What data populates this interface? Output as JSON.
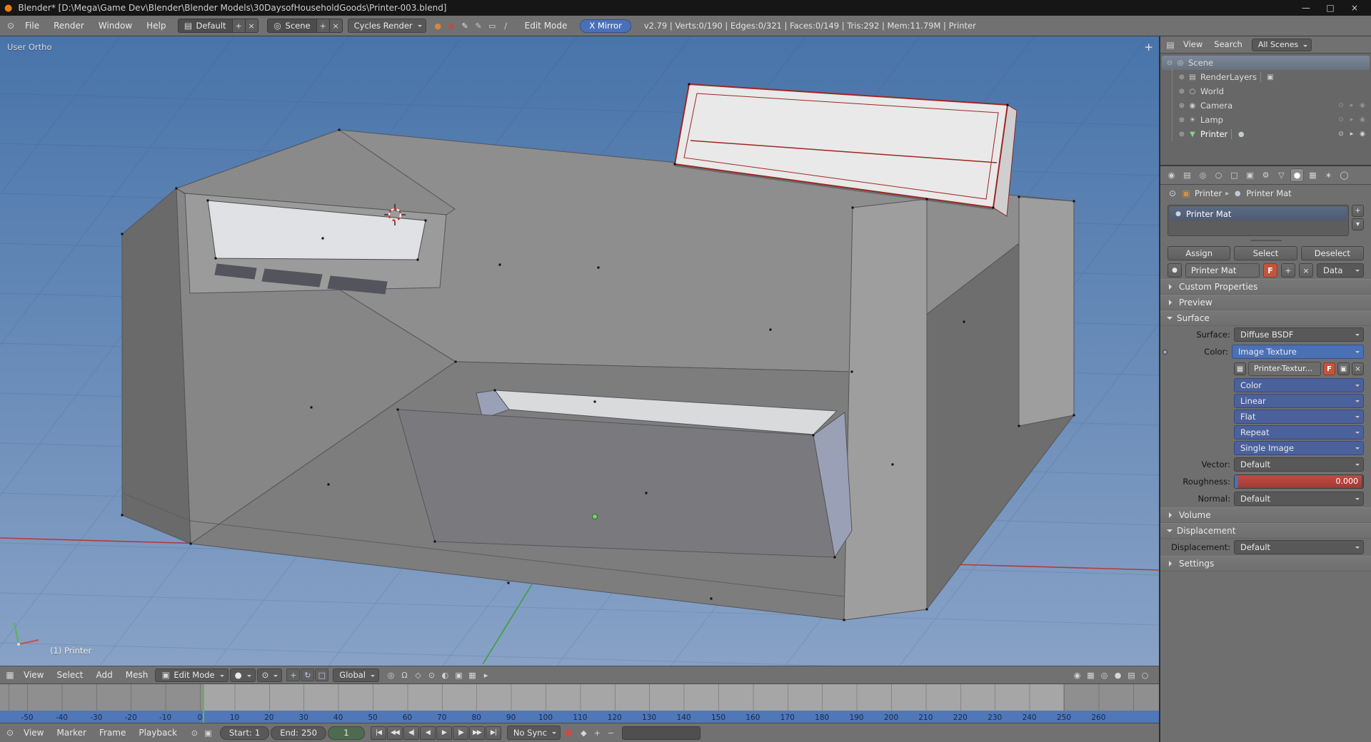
{
  "colors": {
    "accent": "#4a71b8",
    "header": "#717171",
    "panel": "#6f6f6f",
    "widget": "#585858",
    "widget_blue": "#4a619c",
    "widget_blue_bright": "#4a70b5",
    "slider_red": "#b03f3c",
    "strip_blue": "#5077b8",
    "playhead_green": "#62b54f",
    "blender_orange": "#e87d0d",
    "f_button": "#c3553e",
    "vp_top": "#4874aa",
    "vp_bottom": "#88a2c6"
  },
  "titlebar": {
    "logo_glyph": "●",
    "title": "Blender* [D:\\Mega\\Game Dev\\Blender\\Blender Models\\30DaysofHouseholdGoods\\Printer-003.blend]",
    "minimize": "—",
    "maximize": "□",
    "close": "×"
  },
  "menubar": {
    "editor_glyph": "⊙",
    "menus": {
      "file": "File",
      "render": "Render",
      "window": "Window",
      "help": "Help"
    },
    "layout": {
      "icon_glyph": "▤",
      "value": "Default",
      "add": "+",
      "remove": "×"
    },
    "scene": {
      "icon_glyph": "◎",
      "value": "Scene",
      "add": "+",
      "remove": "×"
    },
    "engine": "Cycles Render",
    "icon_cluster": [
      {
        "name": "matcap-sphere-icon",
        "glyph": "●",
        "color": "#d8863b"
      },
      {
        "name": "texture-sphere-icon",
        "glyph": "◉",
        "color": "#c04a42"
      },
      {
        "name": "grease-pencil-icon",
        "glyph": "✎",
        "color": "#e2e2e2"
      },
      {
        "name": "annotate-pen-icon",
        "glyph": "✎",
        "color": "#c8c8c8"
      },
      {
        "name": "ruler-icon",
        "glyph": "▭",
        "color": "#d5d5d5"
      },
      {
        "name": "line-tool-icon",
        "glyph": "∕",
        "color": "#d5d5d5"
      }
    ],
    "mode_label": "Edit Mode",
    "xmirror_label": "X Mirror",
    "stats": "v2.79 | Verts:0/190 | Edges:0/321 | Faces:0/149 | Tris:292 | Mem:11.79M | Printer"
  },
  "viewport": {
    "view_label": "User Ortho",
    "object_label": "(1) Printer",
    "add_panel_glyph": "+"
  },
  "outliner": {
    "editor_glyph": "▤",
    "menus": {
      "view": "View",
      "search": "Search"
    },
    "scenes_filter": "All Scenes",
    "items": [
      {
        "label": "Scene",
        "disclosure": "⊖",
        "icon_glyph": "◎"
      },
      {
        "label": "RenderLayers",
        "disclosure": "⊕",
        "icon_glyph": "▤",
        "trail_icon": "▣"
      },
      {
        "label": "World",
        "disclosure": "⊕",
        "icon_glyph": "○"
      },
      {
        "label": "Camera",
        "disclosure": "⊕",
        "icon_glyph": "◉"
      },
      {
        "label": "Lamp",
        "disclosure": "⊕",
        "icon_glyph": "☀"
      },
      {
        "label": "Printer",
        "disclosure": "⊕",
        "icon_glyph": "▼",
        "trail_icon": "●"
      }
    ],
    "restrict_icons": [
      "⊙",
      "▸",
      "◉"
    ]
  },
  "properties": {
    "tabs": [
      {
        "name": "tab-render",
        "glyph": "◉"
      },
      {
        "name": "tab-render-layers",
        "glyph": "▤"
      },
      {
        "name": "tab-scene",
        "glyph": "◎"
      },
      {
        "name": "tab-world",
        "glyph": "○"
      },
      {
        "name": "tab-object",
        "glyph": "□"
      },
      {
        "name": "tab-constraints",
        "glyph": "▣"
      },
      {
        "name": "tab-modifiers",
        "glyph": "⚙"
      },
      {
        "name": "tab-object-data",
        "glyph": "▽"
      },
      {
        "name": "tab-material",
        "glyph": "●",
        "active": true
      },
      {
        "name": "tab-texture",
        "glyph": "▦"
      },
      {
        "name": "tab-particles",
        "glyph": "∗"
      },
      {
        "name": "tab-physics",
        "glyph": "◯"
      }
    ],
    "breadcrumb": {
      "pin_glyph": "⊙",
      "object_icon": "▣",
      "object": "Printer",
      "arrow": "▸",
      "material_icon": "●",
      "material": "Printer Mat"
    },
    "slot": {
      "item_icon": "●",
      "item": "Printer Mat",
      "add": "+",
      "menu": "▾"
    },
    "actions": {
      "assign": "Assign",
      "select": "Select",
      "deselect": "Deselect"
    },
    "datablock": {
      "browse_icon": "●",
      "name": "Printer Mat",
      "fake_user": "F",
      "add": "+",
      "unlink": "×",
      "link_mode": "Data"
    },
    "sections": {
      "custom_properties": "Custom Properties",
      "preview": "Preview",
      "surface": "Surface",
      "volume": "Volume",
      "displacement": "Displacement",
      "settings": "Settings"
    },
    "surface": {
      "surface_label": "Surface:",
      "surface_value": "Diffuse BSDF",
      "color_label": "Color:",
      "color_value": "Image Texture",
      "texture": {
        "browse_icon": "▦",
        "name": "Printer-Textur...",
        "fake_user": "F",
        "pack_icon": "▣",
        "unlink": "×"
      },
      "tex_options": [
        "Color",
        "Linear",
        "Flat",
        "Repeat",
        "Single Image"
      ],
      "vector_label": "Vector:",
      "vector_value": "Default",
      "roughness_label": "Roughness:",
      "roughness_value": "0.000",
      "normal_label": "Normal:",
      "normal_value": "Default"
    },
    "displacement": {
      "label": "Displacement:",
      "value": "Default"
    }
  },
  "viewport_header": {
    "editor_glyph": "▦",
    "menus": {
      "view": "View",
      "select": "Select",
      "add": "Add",
      "mesh": "Mesh"
    },
    "mode_icon_glyph": "▣",
    "mode": "Edit Mode",
    "shading_glyph": "●",
    "pivot_glyph": "⊙",
    "manip_icons": [
      {
        "name": "manipulator-translate-icon",
        "glyph": "+"
      },
      {
        "name": "manipulator-rotate-icon",
        "glyph": "↻"
      },
      {
        "name": "manipulator-scale-icon",
        "glyph": "□"
      }
    ],
    "orientation": "Global",
    "mid_icons": [
      {
        "name": "proportional-edit-icon",
        "glyph": "◎"
      },
      {
        "name": "snap-magnet-icon",
        "glyph": "Ω"
      },
      {
        "name": "snap-element-icon",
        "glyph": "◇"
      },
      {
        "name": "snap-target-icon",
        "glyph": "⊙"
      },
      {
        "name": "render-preview-icon",
        "glyph": "◐"
      },
      {
        "name": "occlude-geometry-icon",
        "glyph": "▣"
      },
      {
        "name": "normals-display-icon",
        "glyph": "▦"
      },
      {
        "name": "header-expand-icon",
        "glyph": "▸"
      }
    ],
    "right_icons": [
      {
        "name": "opengl-render-icon",
        "glyph": "◉"
      },
      {
        "name": "opengl-anim-icon",
        "glyph": "▦"
      },
      {
        "name": "viewport-shading-extra-icon",
        "glyph": "◎"
      },
      {
        "name": "matcap-icon",
        "glyph": "●"
      },
      {
        "name": "grid-toggle-icon",
        "glyph": "▤"
      },
      {
        "name": "camera-lock-icon",
        "glyph": "○"
      }
    ]
  },
  "timeline": {
    "editor_glyph": "⊙",
    "menus": {
      "view": "View",
      "marker": "Marker",
      "frame": "Frame",
      "playback": "Playback"
    },
    "pre_icons": [
      {
        "name": "use-preview-range-icon",
        "glyph": "⊙"
      },
      {
        "name": "lock-time-icon",
        "glyph": "▣"
      }
    ],
    "start_label": "Start:",
    "start_value": "1",
    "end_label": "End:",
    "end_value": "250",
    "current_frame": "1",
    "playback_buttons": [
      "|◀",
      "◀◀",
      "◀|",
      "◀",
      "▶",
      "|▶",
      "▶▶",
      "▶|"
    ],
    "sync": "No Sync",
    "record_glyph": "●",
    "keying_icons": [
      {
        "name": "keying-set-diamond-icon",
        "glyph": "◆"
      },
      {
        "name": "insert-keyframe-icon",
        "glyph": "+"
      },
      {
        "name": "delete-keyframe-icon",
        "glyph": "−"
      }
    ],
    "ruler_ticks": [
      "-50",
      "-40",
      "-30",
      "-20",
      "-10",
      "0",
      "10",
      "20",
      "30",
      "40",
      "50",
      "60",
      "70",
      "80",
      "90",
      "100",
      "110",
      "120",
      "130",
      "140",
      "150",
      "160",
      "170",
      "180",
      "190",
      "200",
      "210",
      "220",
      "230",
      "240",
      "250",
      "260"
    ]
  }
}
